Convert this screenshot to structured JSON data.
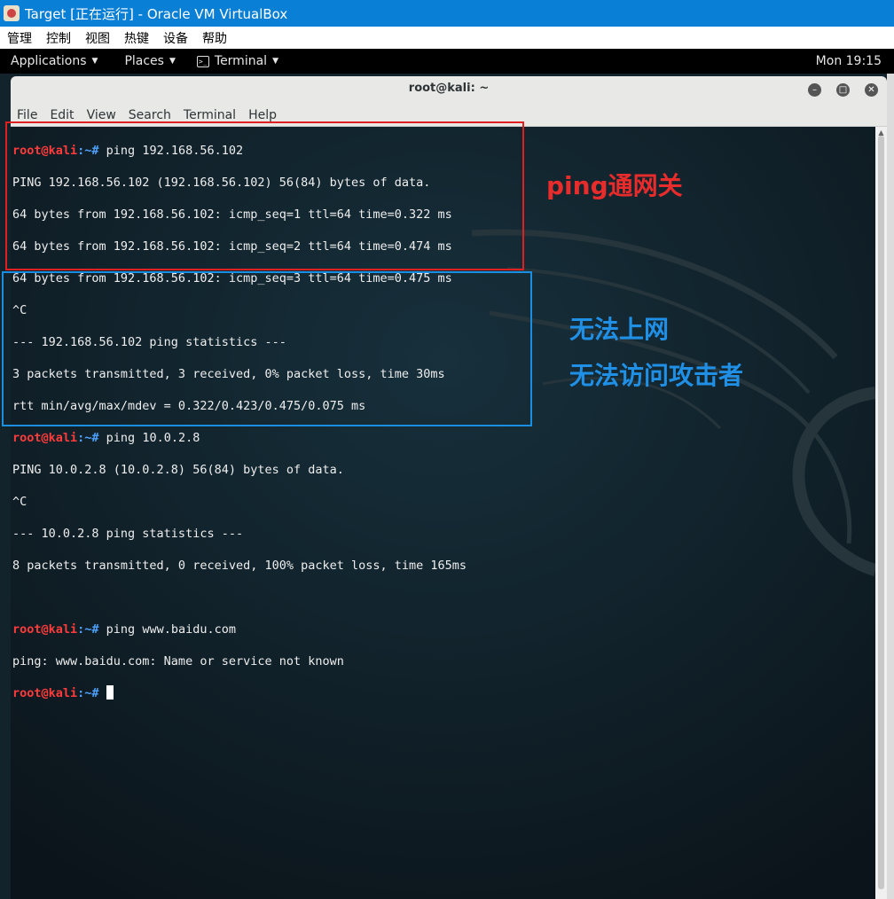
{
  "vbox": {
    "title": "Target [正在运行] - Oracle VM VirtualBox",
    "menu": [
      "管理",
      "控制",
      "视图",
      "热键",
      "设备",
      "帮助"
    ]
  },
  "gnome": {
    "applications": "Applications",
    "places": "Places",
    "terminal": "Terminal",
    "clock": "Mon 19:15"
  },
  "window": {
    "title": "root@kali: ~",
    "menu": [
      "File",
      "Edit",
      "View",
      "Search",
      "Terminal",
      "Help"
    ]
  },
  "terminal": {
    "prompt_user": "root@kali",
    "prompt_path": ":~#",
    "cmd1": " ping 192.168.56.102",
    "out1": [
      "PING 192.168.56.102 (192.168.56.102) 56(84) bytes of data.",
      "64 bytes from 192.168.56.102: icmp_seq=1 ttl=64 time=0.322 ms",
      "64 bytes from 192.168.56.102: icmp_seq=2 ttl=64 time=0.474 ms",
      "64 bytes from 192.168.56.102: icmp_seq=3 ttl=64 time=0.475 ms",
      "^C",
      "--- 192.168.56.102 ping statistics ---",
      "3 packets transmitted, 3 received, 0% packet loss, time 30ms",
      "rtt min/avg/max/mdev = 0.322/0.423/0.475/0.075 ms"
    ],
    "cmd2": " ping 10.0.2.8",
    "out2": [
      "PING 10.0.2.8 (10.0.2.8) 56(84) bytes of data.",
      "^C",
      "--- 10.0.2.8 ping statistics ---",
      "8 packets transmitted, 0 received, 100% packet loss, time 165ms",
      ""
    ],
    "cmd3": " ping www.baidu.com",
    "out3": [
      "ping: www.baidu.com: Name or service not known"
    ]
  },
  "annotations": {
    "red": "ping通网关",
    "blue1": "无法上网",
    "blue2": "无法访问攻击者"
  },
  "colors": {
    "vbox_title_bg": "#0a7fd6",
    "prompt_user": "#ff3b3b",
    "prompt_path": "#4da3ff",
    "annotation_red": "#e82b2b",
    "annotation_blue": "#1f90e6"
  }
}
